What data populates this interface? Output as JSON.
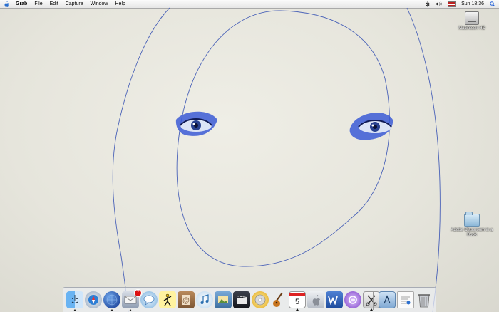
{
  "menubar": {
    "app_name": "Grab",
    "items": [
      "File",
      "Edit",
      "Capture",
      "Window",
      "Help"
    ],
    "clock": "Sun 18:36"
  },
  "desktop_icons": [
    {
      "label": "Macintosh HD",
      "icon": "hard-drive-icon"
    },
    {
      "label": "Adobe Classroom in a Book",
      "icon": "folder-icon"
    }
  ],
  "dock": {
    "items": [
      {
        "name": "finder",
        "icon": "finder-icon",
        "running": true
      },
      {
        "name": "safari",
        "icon": "safari-icon",
        "running": false
      },
      {
        "name": "network",
        "icon": "globe-icon",
        "running": true
      },
      {
        "name": "mail",
        "icon": "mail-icon",
        "running": true,
        "badge": "7"
      },
      {
        "name": "ichat",
        "icon": "ichat-icon",
        "running": false
      },
      {
        "name": "aim",
        "icon": "aim-icon",
        "running": false
      },
      {
        "name": "address-book",
        "icon": "address-book-icon",
        "running": false
      },
      {
        "name": "itunes",
        "icon": "itunes-icon",
        "running": false
      },
      {
        "name": "iphoto",
        "icon": "iphoto-icon",
        "running": false
      },
      {
        "name": "imovie",
        "icon": "imovie-icon",
        "running": false
      },
      {
        "name": "idvd",
        "icon": "idvd-icon",
        "running": false
      },
      {
        "name": "garageband",
        "icon": "garageband-icon",
        "running": false
      },
      {
        "name": "ical",
        "icon": "calendar-icon",
        "running": true,
        "date": "5"
      },
      {
        "name": "system-preferences",
        "icon": "apple-icon",
        "running": false
      },
      {
        "name": "word",
        "icon": "word-icon",
        "running": false
      },
      {
        "name": "entourage",
        "icon": "entourage-icon",
        "running": false
      },
      {
        "name": "grab",
        "icon": "grab-icon",
        "running": true
      },
      {
        "name": "applications",
        "icon": "applications-folder-icon",
        "running": false
      },
      {
        "name": "document",
        "icon": "document-icon",
        "running": false
      },
      {
        "name": "trash",
        "icon": "trash-icon",
        "running": false
      }
    ]
  }
}
